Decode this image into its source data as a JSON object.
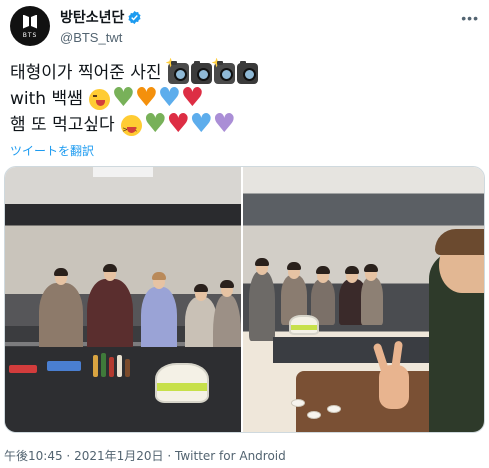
{
  "account": {
    "display_name": "방탄소년단",
    "handle": "@BTS_twt",
    "avatar_text": "BTS",
    "verified": true
  },
  "menu_label": "•••",
  "tweet": {
    "line1_text": "태형이가 찍어준 사진",
    "line1_emoji": [
      "camera-with-flash",
      "camera",
      "camera-with-flash",
      "camera"
    ],
    "line2_text": "with 백쌤",
    "line2_emoji": [
      "winking-face-with-tongue",
      "green-heart",
      "orange-heart",
      "blue-heart",
      "red-heart"
    ],
    "line3_text": "햄 또 먹고싶다",
    "line3_emoji": [
      "squinting-face-with-tongue",
      "green-heart",
      "red-heart",
      "blue-heart",
      "purple-heart"
    ]
  },
  "translate_link": "ツイートを翻訳",
  "footer": {
    "time": "午後10:45",
    "separator": "·",
    "date": "2021年1月20日",
    "source": "Twitter for Android"
  },
  "colors": {
    "link": "#1d9bf0",
    "muted": "#536471",
    "verified": "#1d9bf0"
  }
}
